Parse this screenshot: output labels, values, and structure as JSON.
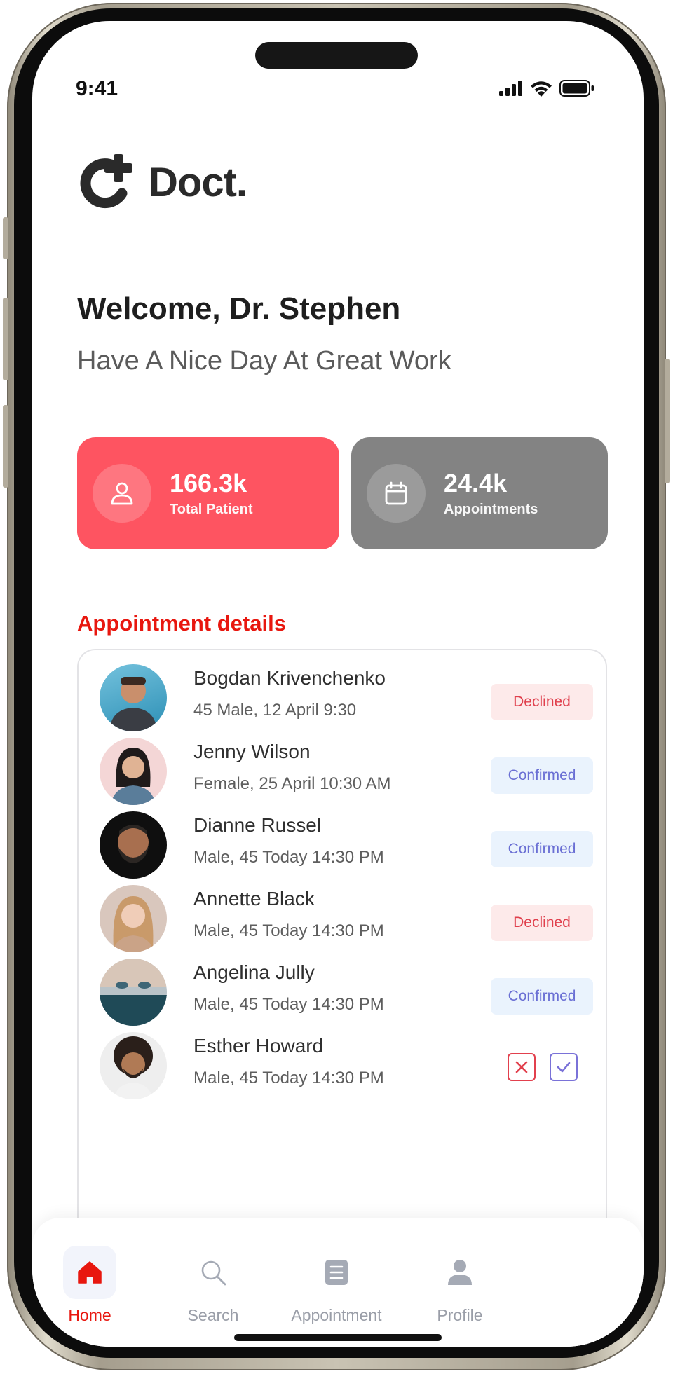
{
  "status_bar": {
    "time": "9:41"
  },
  "app": {
    "logo_text": "Doct."
  },
  "welcome": {
    "title": "Welcome, Dr. Stephen",
    "subtitle": "Have A Nice Day At Great Work"
  },
  "stats": [
    {
      "value": "166.3k",
      "label": "Total Patient",
      "color": "#fe5461",
      "icon": "user-icon"
    },
    {
      "value": "24.4k",
      "label": "Appointments",
      "color": "#838383",
      "icon": "calendar-icon"
    }
  ],
  "appointments": {
    "title": "Appointment details",
    "items": [
      {
        "name": "Bogdan Krivenchenko",
        "info": "45 Male, 12 April 9:30",
        "status": "Declined"
      },
      {
        "name": "Jenny Wilson",
        "info": "Female, 25 April 10:30 AM",
        "status": "Confirmed"
      },
      {
        "name": "Dianne Russel",
        "info": "Male, 45 Today 14:30 PM",
        "status": "Confirmed"
      },
      {
        "name": "Annette Black",
        "info": "Male, 45 Today 14:30 PM",
        "status": "Declined"
      },
      {
        "name": "Angelina Jully",
        "info": "Male, 45 Today 14:30 PM",
        "status": "Confirmed"
      },
      {
        "name": "Esther Howard",
        "info": "Male, 45 Today 14:30 PM",
        "status": ""
      }
    ]
  },
  "nav": {
    "home": "Home",
    "search": "Search",
    "appointment": "Appointment",
    "profile": "Profile"
  },
  "colors": {
    "accent": "#e8170f",
    "patients_card": "#fe5461",
    "appointments_card": "#838383",
    "declined": "#e0404d",
    "confirmed": "#6a6fd4"
  }
}
